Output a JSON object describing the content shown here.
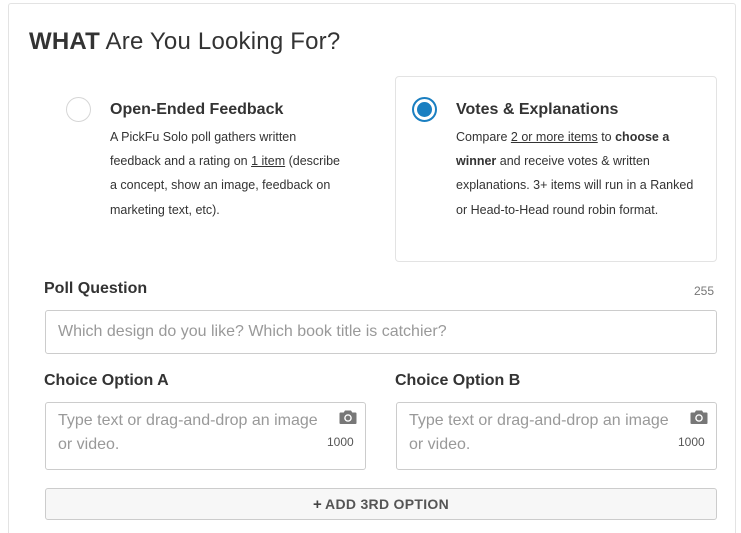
{
  "heading": {
    "bold": "WHAT",
    "rest": " Are You Looking For?"
  },
  "poll_types": {
    "open_ended": {
      "title": "Open-Ended Feedback",
      "desc_1": "A PickFu Solo poll gathers written feedback and a rating on ",
      "desc_link": "1 item",
      "desc_2": " (describe a concept, show an image, feedback on marketing text, etc).",
      "selected": false
    },
    "votes": {
      "title": "Votes & Explanations",
      "desc_1": "Compare ",
      "desc_link": "2 or more items",
      "desc_2": " to ",
      "desc_bold_1": "choose a winner",
      "desc_3": " and receive votes & written explanations. 3+ items will run in a Ranked or Head-to-Head round robin format.",
      "selected": true
    }
  },
  "poll_question": {
    "label": "Poll Question",
    "counter": "255",
    "placeholder": "Which design do you like?  Which book title is catchier?"
  },
  "choice_a": {
    "label": "Choice Option A",
    "placeholder": "Type text or drag-and-drop an image or video.",
    "counter": "1000",
    "icon": "camera-icon"
  },
  "choice_b": {
    "label": "Choice Option B",
    "placeholder": "Type text or drag-and-drop an image or video.",
    "counter": "1000",
    "icon": "camera-icon"
  },
  "add_option": {
    "icon": "+",
    "label": "ADD 3RD OPTION"
  },
  "colors": {
    "accent": "#1a7fc1",
    "border": "#cccccc",
    "placeholder": "#999999"
  }
}
